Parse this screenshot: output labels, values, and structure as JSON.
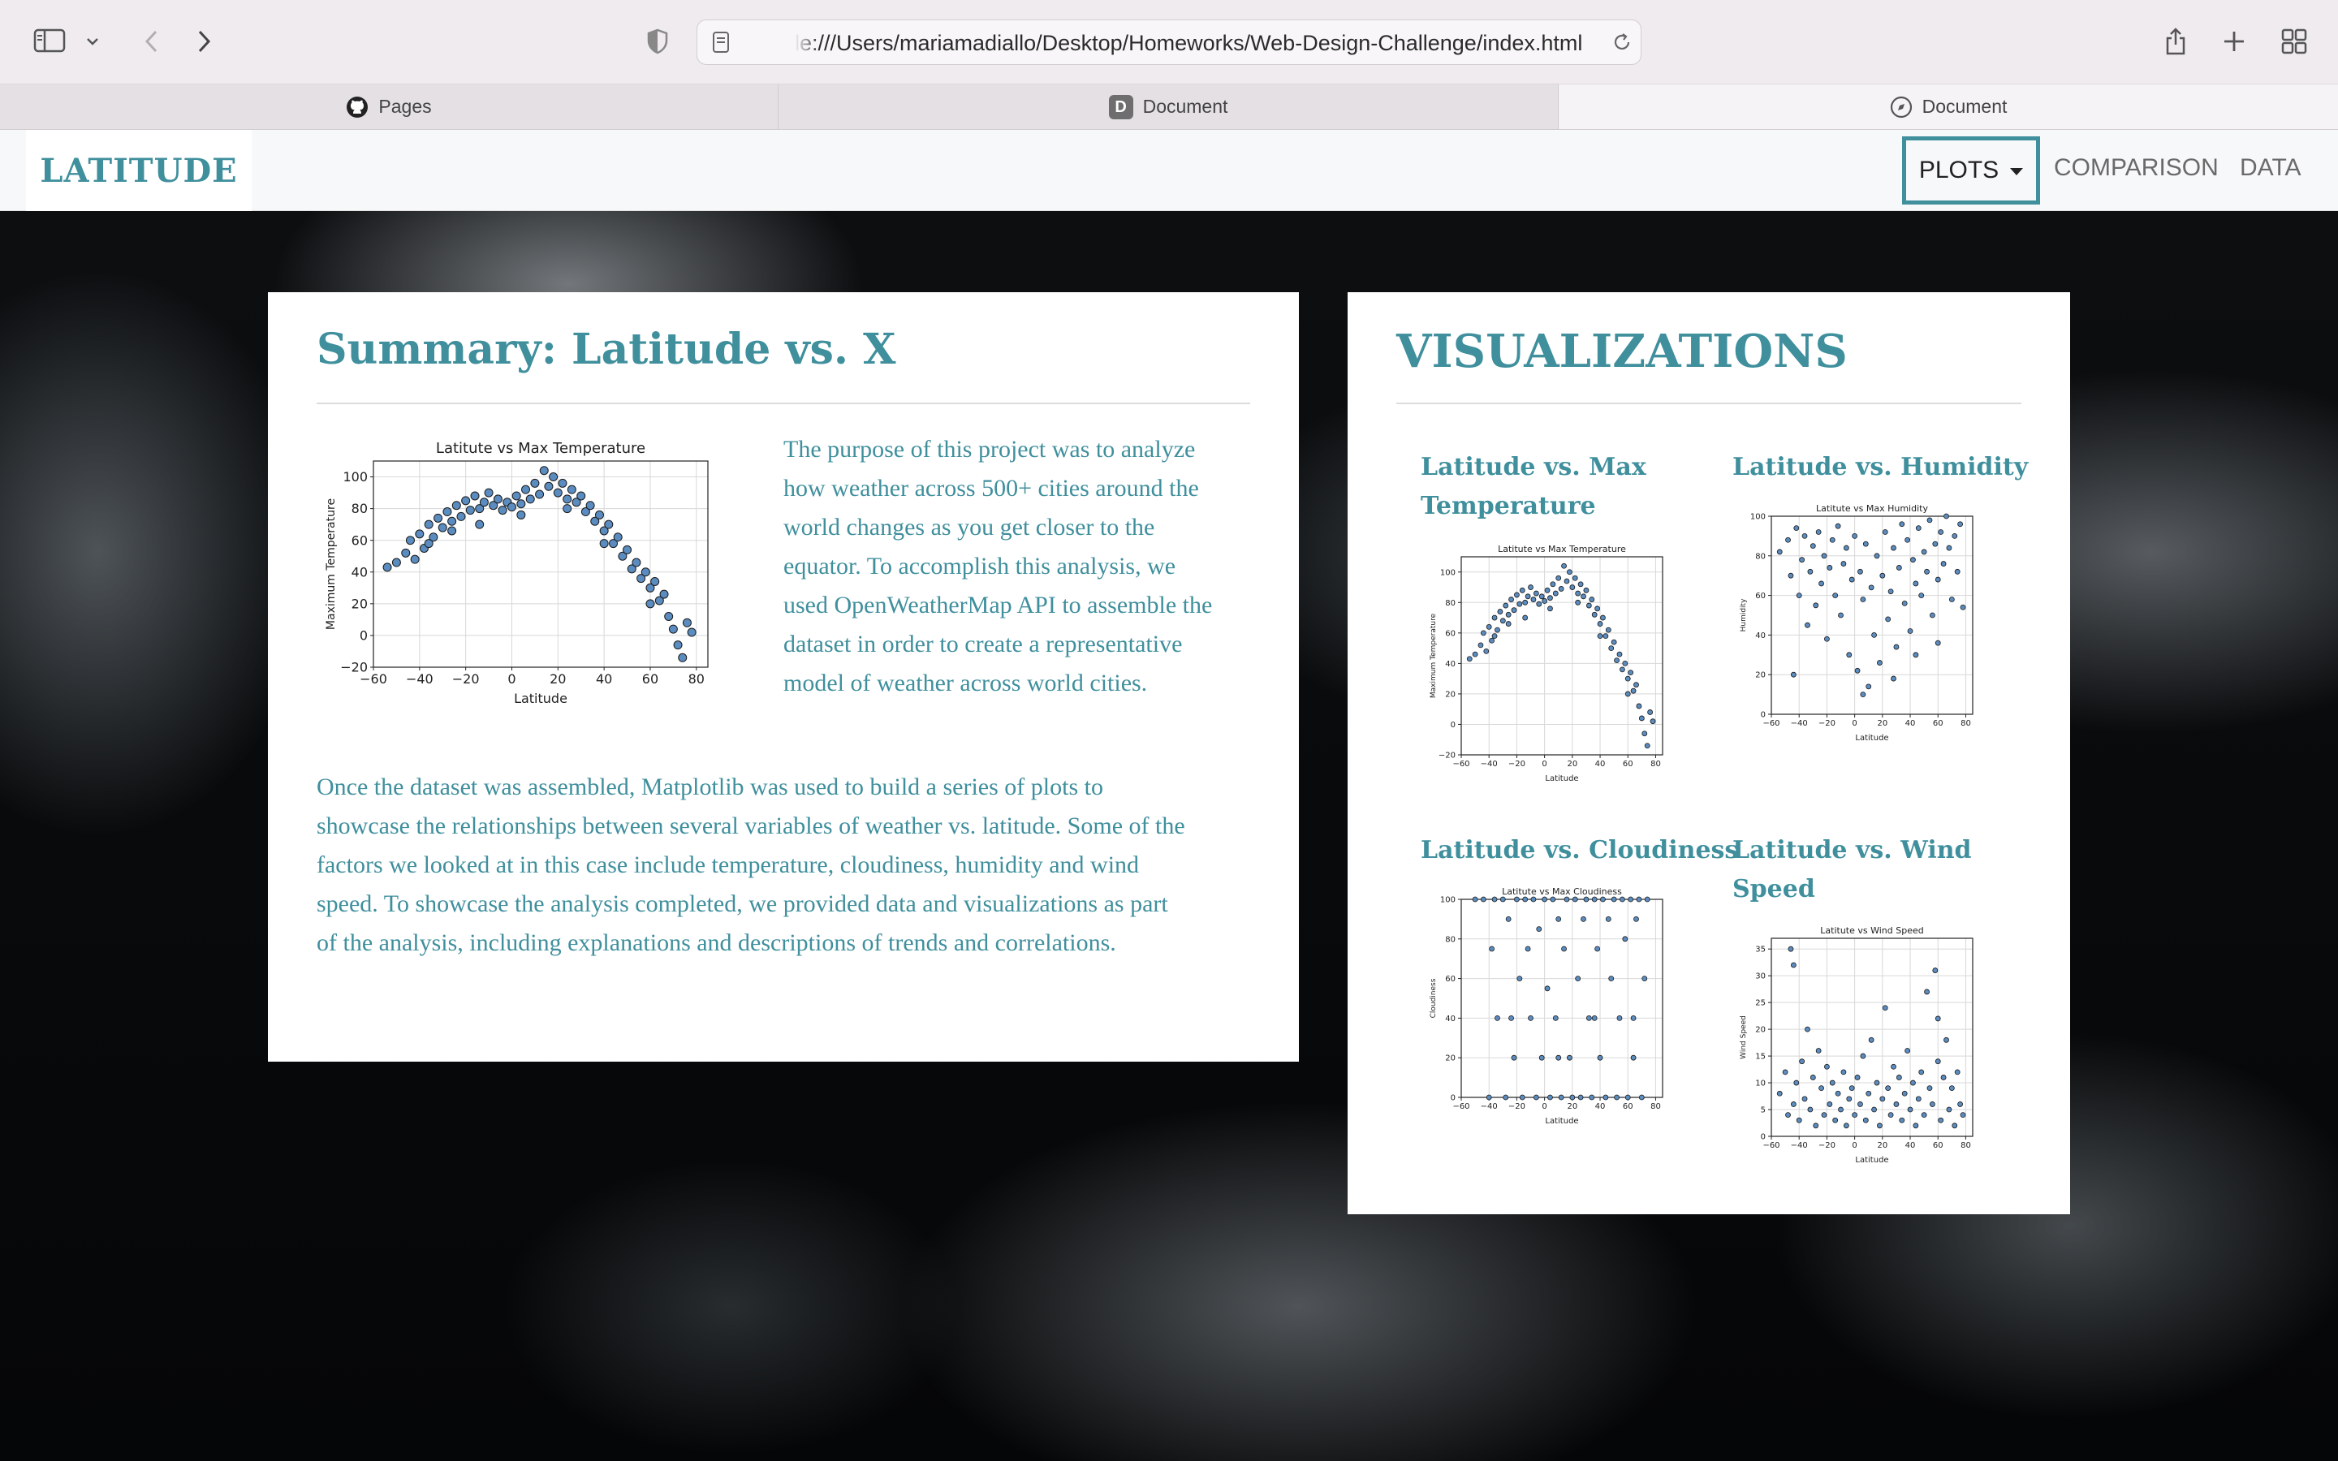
{
  "browser": {
    "url": "le:///Users/mariamadiallo/Desktop/Homeworks/Web-Design-Challenge/index.html",
    "tabs": [
      {
        "label": "Pages",
        "icon": "github-icon"
      },
      {
        "label": "Document",
        "icon": "d-badge-icon",
        "badge": "D"
      },
      {
        "label": "Document",
        "icon": "compass-icon"
      }
    ]
  },
  "navbar": {
    "brand": "LATITUDE",
    "dropdown": "PLOTS",
    "links": [
      "COMPARISON",
      "DATA"
    ]
  },
  "summary": {
    "title": "Summary: Latitude vs. X",
    "intro_lines": [
      "The purpose of this project was to analyze",
      "how weather across 500+ cities around the",
      "world changes as you get closer to the",
      "equator. To accomplish this analysis, we",
      "used OpenWeatherMap API to assemble the",
      "dataset in order to create a representative",
      "model of weather across world cities."
    ],
    "body_lines": [
      "Once the dataset was assembled, Matplotlib was used to build a series of plots to",
      "showcase the relationships between several variables of weather vs. latitude. Some of the",
      "factors we looked at in this case include temperature, cloudiness, humidity and wind",
      "speed. To showcase the analysis completed, we provided data and visualizations as part",
      "of the analysis, including explanations and descriptions of trends and correlations."
    ]
  },
  "visualizations": {
    "title": "VISUALIZATIONS",
    "items": [
      {
        "title_lines": [
          "Latitude vs. Max",
          "Temperature"
        ]
      },
      {
        "title_lines": [
          "Latitude vs. Humidity"
        ]
      },
      {
        "title_lines": [
          "Latitude vs. Cloudiness"
        ]
      },
      {
        "title_lines": [
          "Latitude vs. Wind",
          "Speed"
        ]
      }
    ]
  },
  "chart_data": [
    {
      "type": "scatter",
      "title": "Latitute vs Max Temperature",
      "xlabel": "Latitude",
      "ylabel": "Maximum Temperature",
      "xlim": [
        -60,
        85
      ],
      "ylim": [
        -20,
        110
      ],
      "xticks": [
        -60,
        -40,
        -20,
        0,
        20,
        40,
        60,
        80
      ],
      "yticks": [
        -20,
        0,
        20,
        40,
        60,
        80,
        100
      ],
      "grid": true,
      "points": [
        [
          -54,
          43
        ],
        [
          -50,
          46
        ],
        [
          -46,
          52
        ],
        [
          -44,
          60
        ],
        [
          -42,
          48
        ],
        [
          -40,
          64
        ],
        [
          -38,
          55
        ],
        [
          -36,
          70
        ],
        [
          -34,
          62
        ],
        [
          -32,
          74
        ],
        [
          -30,
          68
        ],
        [
          -28,
          78
        ],
        [
          -26,
          72
        ],
        [
          -24,
          82
        ],
        [
          -22,
          75
        ],
        [
          -20,
          85
        ],
        [
          -18,
          79
        ],
        [
          -16,
          88
        ],
        [
          -14,
          80
        ],
        [
          -12,
          84
        ],
        [
          -10,
          90
        ],
        [
          -8,
          82
        ],
        [
          -6,
          86
        ],
        [
          -4,
          79
        ],
        [
          -2,
          84
        ],
        [
          0,
          81
        ],
        [
          2,
          88
        ],
        [
          4,
          83
        ],
        [
          6,
          92
        ],
        [
          8,
          86
        ],
        [
          10,
          96
        ],
        [
          12,
          89
        ],
        [
          14,
          104
        ],
        [
          16,
          94
        ],
        [
          18,
          100
        ],
        [
          20,
          90
        ],
        [
          22,
          96
        ],
        [
          24,
          86
        ],
        [
          26,
          92
        ],
        [
          28,
          84
        ],
        [
          30,
          88
        ],
        [
          32,
          78
        ],
        [
          34,
          82
        ],
        [
          36,
          72
        ],
        [
          38,
          76
        ],
        [
          40,
          66
        ],
        [
          42,
          70
        ],
        [
          44,
          58
        ],
        [
          46,
          62
        ],
        [
          48,
          50
        ],
        [
          50,
          54
        ],
        [
          52,
          42
        ],
        [
          54,
          46
        ],
        [
          56,
          36
        ],
        [
          58,
          40
        ],
        [
          60,
          30
        ],
        [
          62,
          34
        ],
        [
          64,
          22
        ],
        [
          66,
          26
        ],
        [
          68,
          12
        ],
        [
          70,
          4
        ],
        [
          72,
          -6
        ],
        [
          74,
          -14
        ],
        [
          76,
          8
        ],
        [
          78,
          2
        ],
        [
          -36,
          58
        ],
        [
          -26,
          66
        ],
        [
          -14,
          70
        ],
        [
          4,
          76
        ],
        [
          24,
          80
        ],
        [
          40,
          58
        ],
        [
          60,
          20
        ]
      ]
    },
    {
      "type": "scatter",
      "title": "Latitute vs Max Humidity",
      "xlabel": "Latitude",
      "ylabel": "Humidity",
      "xlim": [
        -60,
        85
      ],
      "ylim": [
        0,
        100
      ],
      "xticks": [
        -60,
        -40,
        -20,
        0,
        20,
        40,
        60,
        80
      ],
      "yticks": [
        0,
        20,
        40,
        60,
        80,
        100
      ],
      "grid": true,
      "points": [
        [
          -54,
          82
        ],
        [
          -48,
          88
        ],
        [
          -46,
          70
        ],
        [
          -42,
          94
        ],
        [
          -40,
          60
        ],
        [
          -38,
          78
        ],
        [
          -36,
          90
        ],
        [
          -34,
          45
        ],
        [
          -32,
          72
        ],
        [
          -30,
          85
        ],
        [
          -28,
          55
        ],
        [
          -26,
          92
        ],
        [
          -24,
          66
        ],
        [
          -22,
          80
        ],
        [
          -20,
          38
        ],
        [
          -18,
          74
        ],
        [
          -16,
          88
        ],
        [
          -14,
          60
        ],
        [
          -12,
          95
        ],
        [
          -10,
          50
        ],
        [
          -8,
          76
        ],
        [
          -6,
          84
        ],
        [
          -4,
          30
        ],
        [
          -2,
          68
        ],
        [
          0,
          90
        ],
        [
          2,
          22
        ],
        [
          4,
          72
        ],
        [
          6,
          58
        ],
        [
          8,
          86
        ],
        [
          10,
          14
        ],
        [
          12,
          64
        ],
        [
          14,
          40
        ],
        [
          16,
          80
        ],
        [
          18,
          26
        ],
        [
          20,
          70
        ],
        [
          22,
          92
        ],
        [
          24,
          48
        ],
        [
          26,
          62
        ],
        [
          28,
          84
        ],
        [
          30,
          34
        ],
        [
          32,
          74
        ],
        [
          34,
          96
        ],
        [
          36,
          56
        ],
        [
          38,
          88
        ],
        [
          40,
          42
        ],
        [
          42,
          78
        ],
        [
          44,
          66
        ],
        [
          46,
          94
        ],
        [
          48,
          60
        ],
        [
          50,
          82
        ],
        [
          52,
          72
        ],
        [
          54,
          98
        ],
        [
          56,
          50
        ],
        [
          58,
          86
        ],
        [
          60,
          68
        ],
        [
          62,
          92
        ],
        [
          64,
          76
        ],
        [
          66,
          100
        ],
        [
          68,
          84
        ],
        [
          70,
          58
        ],
        [
          72,
          90
        ],
        [
          74,
          72
        ],
        [
          76,
          96
        ],
        [
          78,
          54
        ],
        [
          -44,
          20
        ],
        [
          6,
          10
        ],
        [
          28,
          18
        ],
        [
          44,
          30
        ],
        [
          60,
          36
        ]
      ]
    },
    {
      "type": "scatter",
      "title": "Latitute vs Max Cloudiness",
      "xlabel": "Latitude",
      "ylabel": "Cloudiness",
      "xlim": [
        -60,
        85
      ],
      "ylim": [
        0,
        100
      ],
      "xticks": [
        -60,
        -40,
        -20,
        0,
        20,
        40,
        60,
        80
      ],
      "yticks": [
        0,
        20,
        40,
        60,
        80,
        100
      ],
      "grid": true,
      "points": [
        [
          -50,
          100
        ],
        [
          -44,
          100
        ],
        [
          -40,
          0
        ],
        [
          -38,
          75
        ],
        [
          -36,
          100
        ],
        [
          -34,
          40
        ],
        [
          -30,
          100
        ],
        [
          -28,
          0
        ],
        [
          -26,
          90
        ],
        [
          -22,
          20
        ],
        [
          -20,
          100
        ],
        [
          -18,
          60
        ],
        [
          -16,
          0
        ],
        [
          -14,
          100
        ],
        [
          -12,
          75
        ],
        [
          -10,
          40
        ],
        [
          -8,
          100
        ],
        [
          -6,
          0
        ],
        [
          -4,
          85
        ],
        [
          -2,
          20
        ],
        [
          0,
          100
        ],
        [
          2,
          55
        ],
        [
          4,
          0
        ],
        [
          6,
          100
        ],
        [
          8,
          40
        ],
        [
          10,
          90
        ],
        [
          12,
          0
        ],
        [
          14,
          75
        ],
        [
          16,
          100
        ],
        [
          18,
          20
        ],
        [
          20,
          0
        ],
        [
          22,
          100
        ],
        [
          24,
          60
        ],
        [
          26,
          0
        ],
        [
          28,
          90
        ],
        [
          30,
          100
        ],
        [
          32,
          40
        ],
        [
          34,
          0
        ],
        [
          36,
          100
        ],
        [
          38,
          75
        ],
        [
          40,
          20
        ],
        [
          42,
          100
        ],
        [
          44,
          0
        ],
        [
          46,
          90
        ],
        [
          48,
          60
        ],
        [
          50,
          100
        ],
        [
          52,
          0
        ],
        [
          54,
          40
        ],
        [
          56,
          100
        ],
        [
          58,
          80
        ],
        [
          60,
          0
        ],
        [
          62,
          100
        ],
        [
          64,
          20
        ],
        [
          66,
          90
        ],
        [
          68,
          100
        ],
        [
          70,
          0
        ],
        [
          72,
          60
        ],
        [
          74,
          100
        ],
        [
          -24,
          40
        ],
        [
          10,
          20
        ],
        [
          36,
          40
        ],
        [
          64,
          40
        ]
      ]
    },
    {
      "type": "scatter",
      "title": "Latitute vs Wind Speed",
      "xlabel": "Latitude",
      "ylabel": "Wind Speed",
      "xlim": [
        -60,
        85
      ],
      "ylim": [
        0,
        37
      ],
      "xticks": [
        -60,
        -40,
        -20,
        0,
        20,
        40,
        60,
        80
      ],
      "yticks": [
        0,
        5,
        10,
        15,
        20,
        25,
        30,
        35
      ],
      "grid": true,
      "points": [
        [
          -54,
          8
        ],
        [
          -50,
          12
        ],
        [
          -48,
          4
        ],
        [
          -46,
          35
        ],
        [
          -44,
          6
        ],
        [
          -42,
          10
        ],
        [
          -40,
          3
        ],
        [
          -38,
          14
        ],
        [
          -36,
          7
        ],
        [
          -34,
          20
        ],
        [
          -32,
          5
        ],
        [
          -30,
          11
        ],
        [
          -28,
          2
        ],
        [
          -26,
          16
        ],
        [
          -24,
          9
        ],
        [
          -22,
          4
        ],
        [
          -20,
          13
        ],
        [
          -18,
          6
        ],
        [
          -16,
          10
        ],
        [
          -14,
          3
        ],
        [
          -12,
          8
        ],
        [
          -10,
          5
        ],
        [
          -8,
          12
        ],
        [
          -6,
          2
        ],
        [
          -4,
          7
        ],
        [
          -2,
          9
        ],
        [
          0,
          4
        ],
        [
          2,
          11
        ],
        [
          4,
          6
        ],
        [
          6,
          15
        ],
        [
          8,
          3
        ],
        [
          10,
          8
        ],
        [
          12,
          18
        ],
        [
          14,
          5
        ],
        [
          16,
          10
        ],
        [
          18,
          2
        ],
        [
          20,
          7
        ],
        [
          22,
          24
        ],
        [
          24,
          9
        ],
        [
          26,
          4
        ],
        [
          28,
          13
        ],
        [
          30,
          6
        ],
        [
          32,
          11
        ],
        [
          34,
          3
        ],
        [
          36,
          8
        ],
        [
          38,
          16
        ],
        [
          40,
          5
        ],
        [
          42,
          10
        ],
        [
          44,
          2
        ],
        [
          46,
          7
        ],
        [
          48,
          12
        ],
        [
          50,
          4
        ],
        [
          52,
          27
        ],
        [
          54,
          9
        ],
        [
          56,
          6
        ],
        [
          58,
          31
        ],
        [
          60,
          14
        ],
        [
          62,
          3
        ],
        [
          64,
          11
        ],
        [
          66,
          18
        ],
        [
          68,
          5
        ],
        [
          70,
          9
        ],
        [
          72,
          2
        ],
        [
          74,
          12
        ],
        [
          76,
          6
        ],
        [
          78,
          4
        ],
        [
          -44,
          32
        ],
        [
          60,
          22
        ]
      ]
    }
  ]
}
